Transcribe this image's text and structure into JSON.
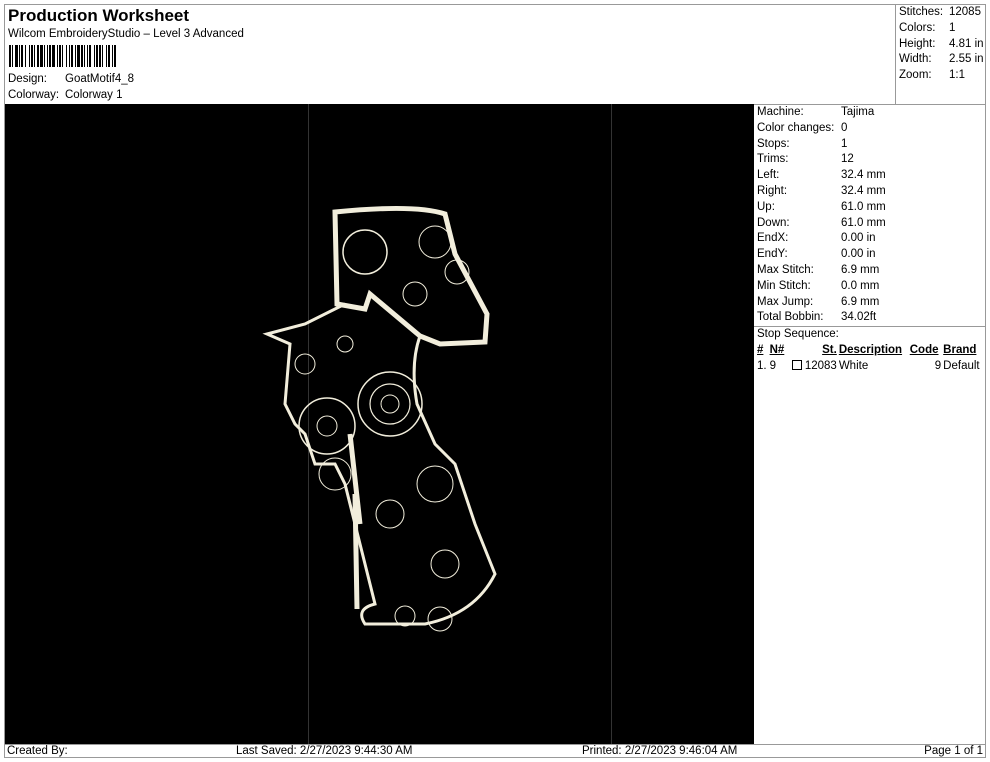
{
  "header": {
    "title": "Production Worksheet",
    "subtitle": "Wilcom EmbroideryStudio – Level 3 Advanced",
    "design_label": "Design:",
    "design_value": "GoatMotif4_8",
    "colorway_label": "Colorway:",
    "colorway_value": "Colorway 1"
  },
  "summary": [
    {
      "k": "Stitches:",
      "v": "12085"
    },
    {
      "k": "Colors:",
      "v": "1"
    },
    {
      "k": "Height:",
      "v": "4.81 in"
    },
    {
      "k": "Width:",
      "v": "2.55 in"
    },
    {
      "k": "Zoom:",
      "v": "1:1"
    }
  ],
  "details": [
    {
      "k": "Machine:",
      "v": "Tajima"
    },
    {
      "k": "Color changes:",
      "v": "0"
    },
    {
      "k": "Stops:",
      "v": "1"
    },
    {
      "k": "Trims:",
      "v": "12"
    },
    {
      "k": "Left:",
      "v": "32.4 mm"
    },
    {
      "k": "Right:",
      "v": "32.4 mm"
    },
    {
      "k": "Up:",
      "v": "61.0 mm"
    },
    {
      "k": "Down:",
      "v": "61.0 mm"
    },
    {
      "k": "EndX:",
      "v": "0.00 in"
    },
    {
      "k": "EndY:",
      "v": "0.00 in"
    },
    {
      "k": "Max Stitch:",
      "v": "6.9 mm"
    },
    {
      "k": "Min Stitch:",
      "v": "0.0 mm"
    },
    {
      "k": "Max Jump:",
      "v": "6.9 mm"
    },
    {
      "k": "Total Bobbin:",
      "v": "34.02ft"
    }
  ],
  "stop_sequence": {
    "label": "Stop Sequence:",
    "columns": [
      "#",
      "N#",
      "St.",
      "Description",
      "Code",
      "Brand"
    ],
    "rows": [
      {
        "num": "1.",
        "n": "9",
        "st": "12083",
        "desc": "White",
        "code": "9",
        "brand": "Default"
      }
    ]
  },
  "footer": {
    "created": "Created By:",
    "saved": "Last Saved: 2/27/2023 9:44:30 AM",
    "printed": "Printed: 2/27/2023 9:46:04 AM",
    "page": "Page 1 of 1"
  },
  "colors": {
    "thread": "#f2eedc",
    "canvas": "#000000"
  }
}
